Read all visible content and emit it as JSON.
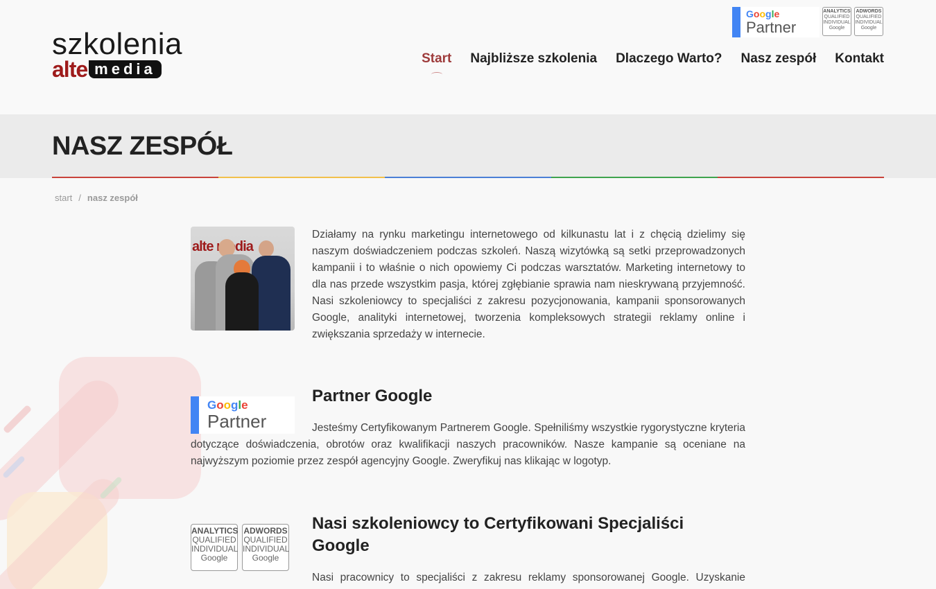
{
  "header": {
    "logo_top": "szkolenia",
    "logo_alte": "alte",
    "logo_media": "media",
    "partner_google": "Google",
    "partner_label": "Partner",
    "badge_analytics": [
      "ANALYTICS",
      "QUALIFIED",
      "INDIVIDUAL",
      "Google"
    ],
    "badge_adwords": [
      "ADWORDS",
      "QUALIFIED",
      "INDIVIDUAL",
      "Google"
    ]
  },
  "nav": {
    "items": [
      {
        "label": "Start",
        "active": true
      },
      {
        "label": "Najbliższe szkolenia",
        "active": false
      },
      {
        "label": "Dlaczego Warto?",
        "active": false
      },
      {
        "label": "Nasz zespół",
        "active": false
      },
      {
        "label": "Kontakt",
        "active": false
      }
    ]
  },
  "page": {
    "title": "NASZ ZESPÓŁ",
    "rainbow_colors": [
      "#c9433a",
      "#f2c04a",
      "#4a7fd6",
      "#3fa34d",
      "#c9433a"
    ]
  },
  "breadcrumb": {
    "home": "start",
    "separator": "/",
    "current": "nasz zespół"
  },
  "sections": {
    "about": {
      "photo_logo": "alte media",
      "text": "Działamy na rynku marketingu internetowego od kilkunastu lat i z chęcią dzielimy się naszym doświadczeniem podczas szkoleń. Naszą wizytówką są setki przeprowadzonych kampanii i to właśnie o nich opowiemy Ci podczas warsztatów. Marketing internetowy to dla nas przede wszystkim pasja, której zgłębianie sprawia nam nieskrywaną przyjemność. Nasi szkoleniowcy to specjaliści z zakresu pozycjonowania, kampanii sponsorowanych Google, analityki internetowej, tworzenia kompleksowych strategii reklamy online i zwiększania sprzedaży w internecie."
    },
    "partner": {
      "title": "Partner Google",
      "logo_google": "Google",
      "logo_partner": "Partner",
      "text": "Jesteśmy Certyfikowanym Partnerem Google. Spełniliśmy wszystkie rygorystyczne kryteria dotyczące doświadczenia, obrotów oraz kwalifikacji naszych pracowników. Nasze kampanie są oceniane na najwyższym poziomie przez zespół agencyjny Google. Zweryfikuj nas klikając w logotyp."
    },
    "certified": {
      "title": "Nasi szkoleniowcy to Certyfikowani Specjaliści Google",
      "badge_analytics": [
        "ANALYTICS",
        "QUALIFIED",
        "INDIVIDUAL",
        "Google"
      ],
      "badge_adwords": [
        "ADWORDS",
        "QUALIFIED",
        "INDIVIDUAL",
        "Google"
      ],
      "text": "Nasi pracownicy to specjaliści z zakresu reklamy sponsorowanej Google. Uzyskanie certyfikatu jest jednoznaczne ze zdaniem egzaminów, poprzedzonych szkoleniami,"
    }
  }
}
